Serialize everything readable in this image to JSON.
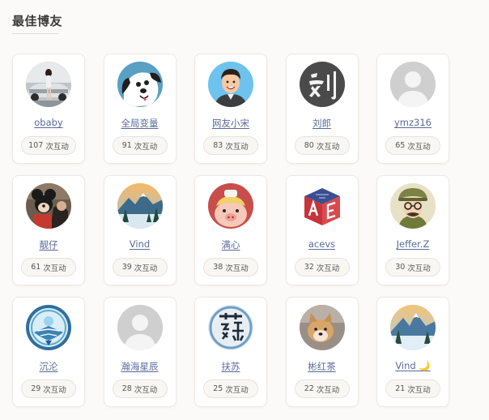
{
  "section": {
    "title": "最佳博友"
  },
  "unit": "次互动",
  "friends": [
    {
      "name": "obaby",
      "count": "107",
      "avatar_icon": "photo-woman-car-icon"
    },
    {
      "name": "全局变量",
      "count": "91",
      "avatar_icon": "cartoon-dog-icon"
    },
    {
      "name": "网友小宋",
      "count": "83",
      "avatar_icon": "cartoon-man-icon"
    },
    {
      "name": "刘郎",
      "count": "80",
      "avatar_icon": "calligraphy-liu-icon"
    },
    {
      "name": "ymz316",
      "count": "65",
      "avatar_icon": "default-user-icon"
    },
    {
      "name": "靓仔",
      "count": "61",
      "avatar_icon": "mickey-photo-icon"
    },
    {
      "name": "Vind",
      "count": "39",
      "avatar_icon": "snow-mountain-icon"
    },
    {
      "name": "满心",
      "count": "38",
      "avatar_icon": "pink-pig-icon"
    },
    {
      "name": "acevs",
      "count": "32",
      "avatar_icon": "ae-cube-logo-icon"
    },
    {
      "name": "Jeffer.Z",
      "count": "30",
      "avatar_icon": "cartoon-explorer-icon"
    },
    {
      "name": "沉沦",
      "count": "29",
      "avatar_icon": "blue-phoenix-icon"
    },
    {
      "name": "瀚海星辰",
      "count": "28",
      "avatar_icon": "default-user-icon"
    },
    {
      "name": "扶苏",
      "count": "25",
      "avatar_icon": "calligraphy-su-icon"
    },
    {
      "name": "彬红茶",
      "count": "22",
      "avatar_icon": "shiba-dog-icon"
    },
    {
      "name": "Vind 🌙",
      "count": "21",
      "avatar_icon": "snow-mountain-icon"
    }
  ],
  "colors": {
    "name_link": "#5a6a9a",
    "card_border": "#ece9e4",
    "background": "#fbfaf8"
  }
}
